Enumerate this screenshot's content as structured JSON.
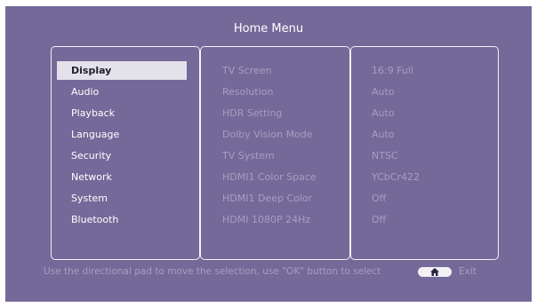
{
  "header": {
    "title": "Home Menu"
  },
  "menu": {
    "items": [
      "Display",
      "Audio",
      "Playback",
      "Language",
      "Security",
      "Network",
      "System",
      "Bluetooth"
    ],
    "selected_index": 0
  },
  "settings": [
    {
      "label": "TV Screen",
      "value": "16:9 Full"
    },
    {
      "label": "Resolution",
      "value": "Auto"
    },
    {
      "label": "HDR Setting",
      "value": "Auto"
    },
    {
      "label": "Dolby Vision Mode",
      "value": "Auto"
    },
    {
      "label": "TV System",
      "value": "NTSC"
    },
    {
      "label": "HDMI1 Color Space",
      "value": "YCbCr422"
    },
    {
      "label": "HDMI1 Deep Color",
      "value": "Off"
    },
    {
      "label": "HDMI 1080P 24Hz",
      "value": "Off"
    }
  ],
  "footer": {
    "hint": "Use the directional pad to move the selection, use \"OK\" button to select",
    "home_icon": "home-icon",
    "exit_label": "Exit"
  }
}
